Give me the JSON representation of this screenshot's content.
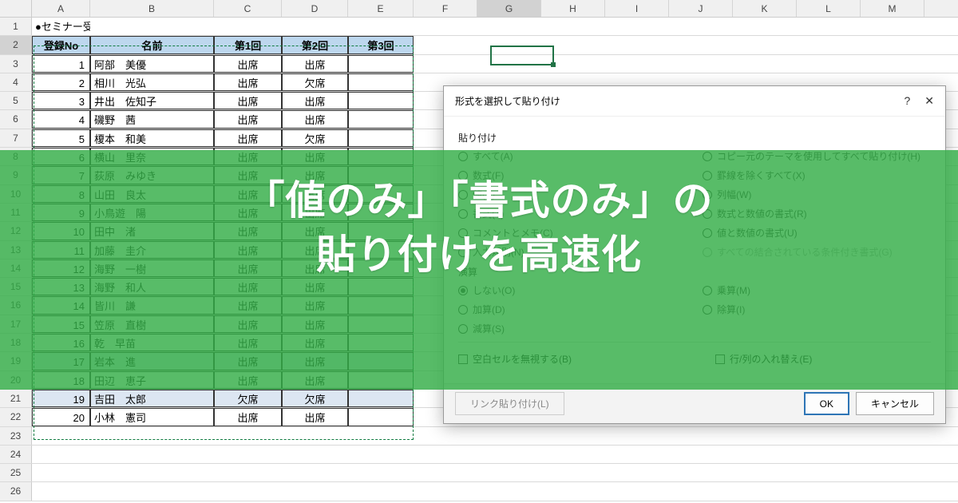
{
  "columns": [
    "A",
    "B",
    "C",
    "D",
    "E",
    "F",
    "G",
    "H",
    "I",
    "J",
    "K",
    "L",
    "M"
  ],
  "selectedCol": "G",
  "selectedRow": 2,
  "title": "●セミナー受講者名簿",
  "headers": {
    "no": "登録No",
    "name": "名前",
    "r1": "第1回",
    "r2": "第2回",
    "r3": "第3回"
  },
  "rows": [
    {
      "no": 1,
      "name": "阿部　美優",
      "r1": "出席",
      "r2": "出席",
      "alt": false
    },
    {
      "no": 2,
      "name": "相川　光弘",
      "r1": "出席",
      "r2": "欠席",
      "alt": false
    },
    {
      "no": 3,
      "name": "井出　佐知子",
      "r1": "出席",
      "r2": "出席",
      "alt": false
    },
    {
      "no": 4,
      "name": "磯野　茜",
      "r1": "出席",
      "r2": "出席",
      "alt": false
    },
    {
      "no": 5,
      "name": "榎本　和美",
      "r1": "出席",
      "r2": "欠席",
      "alt": false
    },
    {
      "no": 6,
      "name": "横山　里奈",
      "r1": "出席",
      "r2": "出席",
      "alt": false
    },
    {
      "no": 7,
      "name": "荻原　みゆき",
      "r1": "出席",
      "r2": "出席",
      "alt": false
    },
    {
      "no": 8,
      "name": "山田　良太",
      "r1": "出席",
      "r2": "出席",
      "alt": false
    },
    {
      "no": 9,
      "name": "小鳥遊　陽",
      "r1": "出席",
      "r2": "出席",
      "alt": false
    },
    {
      "no": 10,
      "name": "田中　渚",
      "r1": "出席",
      "r2": "出席",
      "alt": false
    },
    {
      "no": 11,
      "name": "加藤　圭介",
      "r1": "出席",
      "r2": "出席",
      "alt": false
    },
    {
      "no": 12,
      "name": "海野　一樹",
      "r1": "出席",
      "r2": "出席",
      "alt": false
    },
    {
      "no": 13,
      "name": "海野　和人",
      "r1": "出席",
      "r2": "出席",
      "alt": false
    },
    {
      "no": 14,
      "name": "皆川　謙",
      "r1": "出席",
      "r2": "出席",
      "alt": false
    },
    {
      "no": 15,
      "name": "笠原　直樹",
      "r1": "出席",
      "r2": "出席",
      "alt": false
    },
    {
      "no": 16,
      "name": "乾　早苗",
      "r1": "出席",
      "r2": "出席",
      "alt": false
    },
    {
      "no": 17,
      "name": "岩本　進",
      "r1": "出席",
      "r2": "出席",
      "alt": true
    },
    {
      "no": 18,
      "name": "田辺　恵子",
      "r1": "出席",
      "r2": "出席",
      "alt": false
    },
    {
      "no": 19,
      "name": "吉田　太郎",
      "r1": "欠席",
      "r2": "欠席",
      "alt": true
    },
    {
      "no": 20,
      "name": "小林　憲司",
      "r1": "出席",
      "r2": "出席",
      "alt": false
    }
  ],
  "dialog": {
    "title": "形式を選択して貼り付け",
    "help": "?",
    "close": "✕",
    "sec1": "貼り付け",
    "opts1L": [
      {
        "t": "すべて(A)",
        "on": false
      },
      {
        "t": "数式(F)",
        "on": false
      },
      {
        "t": "値(V)",
        "on": false
      },
      {
        "t": "書式(T)",
        "on": false
      },
      {
        "t": "コメントとメモ(C)",
        "on": false
      },
      {
        "t": "入力規則(N)",
        "on": false
      }
    ],
    "opts1R": [
      {
        "t": "コピー元のテーマを使用してすべて貼り付け(H)",
        "on": false
      },
      {
        "t": "罫線を除くすべて(X)",
        "on": false
      },
      {
        "t": "列幅(W)",
        "on": false
      },
      {
        "t": "数式と数値の書式(R)",
        "on": false
      },
      {
        "t": "値と数値の書式(U)",
        "on": false
      },
      {
        "t": "すべての結合されている条件付き書式(G)",
        "on": false,
        "dim": true
      }
    ],
    "sec2": "演算",
    "opts2L": [
      {
        "t": "しない(O)",
        "on": true
      },
      {
        "t": "加算(D)",
        "on": false
      },
      {
        "t": "減算(S)",
        "on": false
      }
    ],
    "opts2R": [
      {
        "t": "乗算(M)",
        "on": false
      },
      {
        "t": "除算(I)",
        "on": false
      }
    ],
    "chk1": "空白セルを無視する(B)",
    "chk2": "行/列の入れ替え(E)",
    "linkBtn": "リンク貼り付け(L)",
    "ok": "OK",
    "cancel": "キャンセル"
  },
  "banner": {
    "line1": "「値のみ」「書式のみ」の",
    "line2": "貼り付けを高速化"
  }
}
